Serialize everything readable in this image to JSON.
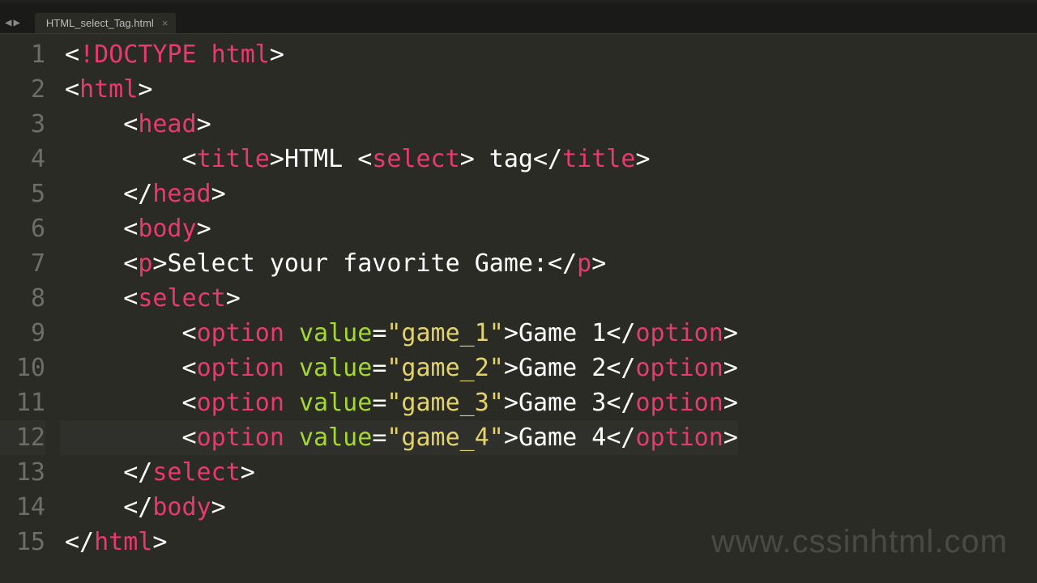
{
  "tabs": {
    "active": {
      "title": "HTML_select_Tag.html"
    }
  },
  "watermark": "www.cssinhtml.com",
  "doc": {
    "doctype": "DOCTYPE html",
    "root": "html",
    "head": "head",
    "title_tag": "title",
    "title_text": "HTML <select> tag",
    "body": "body",
    "p_tag": "p",
    "p_text": "Select your favorite Game:",
    "select": "select",
    "option": "option",
    "value_attr": "value",
    "options": [
      {
        "value": "game_1",
        "text": "Game 1"
      },
      {
        "value": "game_2",
        "text": "Game 2"
      },
      {
        "value": "game_3",
        "text": "Game 3"
      },
      {
        "value": "game_4",
        "text": "Game 4"
      }
    ]
  },
  "line_count": 15,
  "active_line": 12
}
